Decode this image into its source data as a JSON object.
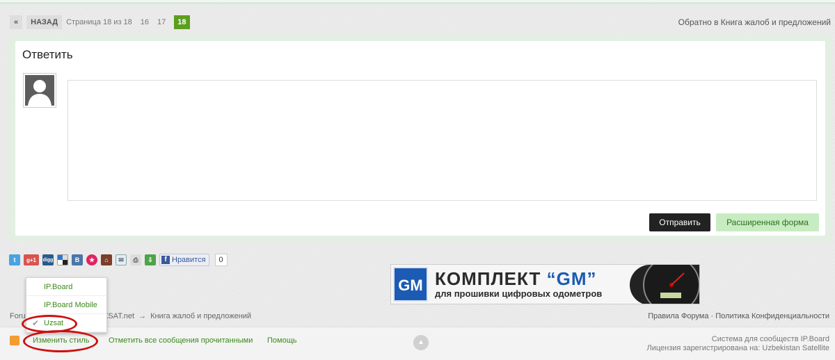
{
  "pagination": {
    "first": "«",
    "back": "НАЗАД",
    "page_info": "Страница 18 из 18",
    "pages": [
      "16",
      "17"
    ],
    "current": "18"
  },
  "back_link": "Обратно в Книга жалоб и предложений",
  "reply": {
    "title": "Ответить",
    "send_label": "Отправить",
    "advanced_label": "Расширенная форма"
  },
  "share": {
    "like_label": "Нравится",
    "like_count": "0",
    "icons": [
      "twitter-icon",
      "google-plus-icon",
      "digg-icon",
      "delicious-icon",
      "vk-icon",
      "star-icon",
      "house-icon",
      "email-icon",
      "print-icon",
      "download-icon"
    ]
  },
  "banner": {
    "logo": "GM",
    "title_prefix": "КОМПЛЕКТ ",
    "title_gm": "“GM”",
    "subtitle": "для прошивки цифровых одометров"
  },
  "breadcrumb": {
    "start": "Foru",
    "site": "ZSAT.net",
    "arrow": "→",
    "current": "Книга жалоб и предложений"
  },
  "footer_links": "Правила Форума · Политика Конфиденциальности",
  "style_menu": {
    "items": [
      "IP.Board",
      "IP.Board Mobile",
      "Uzsat"
    ],
    "active_mark": "✔"
  },
  "bottom": {
    "change_style": "Изменить стиль",
    "mark_read": "Отметить все сообщения прочитанными",
    "help": "Помощь",
    "scroll_top": "▲",
    "copyright_line1": "Система для сообществ IP.Board",
    "copyright_line2": "Лицензия зарегистрирована на: Uzbekistan Satellite"
  },
  "colors": {
    "accent_green": "#5c9e1e",
    "link_green": "#3a8a1a",
    "annotation_red": "#cc1010"
  }
}
